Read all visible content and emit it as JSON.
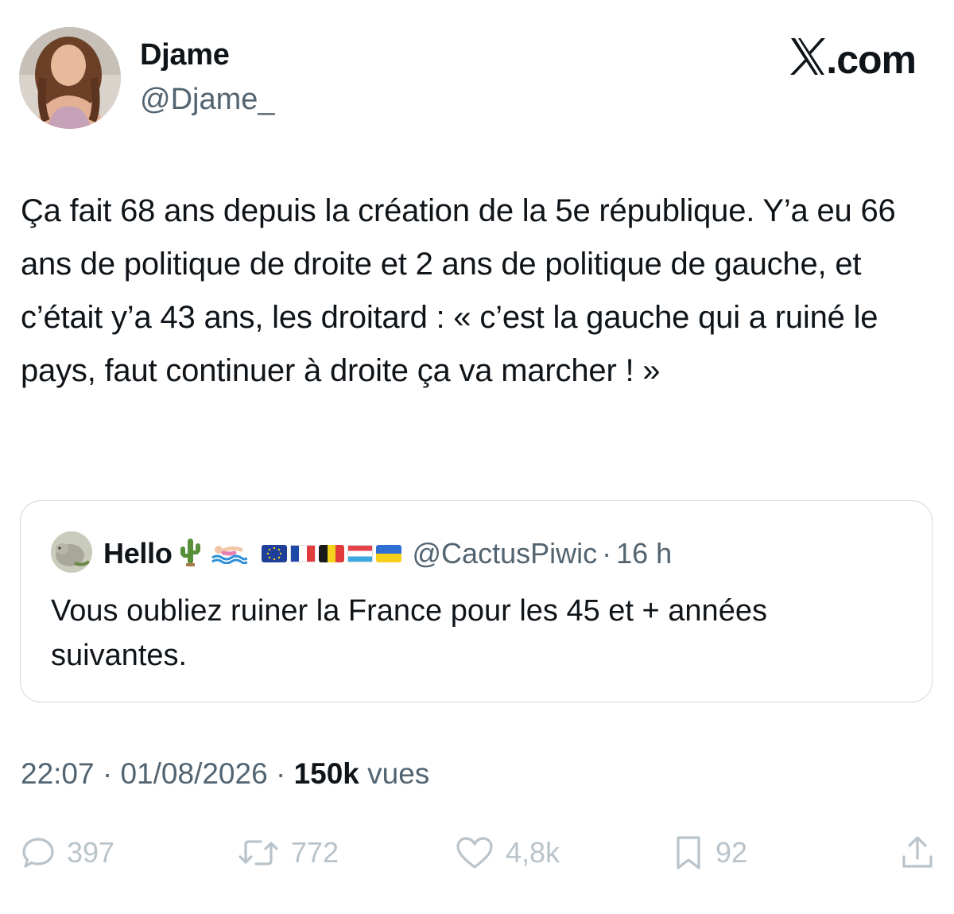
{
  "author": {
    "name": "Djame",
    "handle": "@Djame_"
  },
  "brand": {
    "label": ".com"
  },
  "tweet": {
    "text": "Ça fait 68 ans depuis la création de la 5e république. Y’a eu 66 ans de politique de droite et 2 ans de politique de gauche, et c’était y’a 43 ans, les droitard : « c’est la gauche qui a ruiné le pays, faut continuer à droite ça va marcher ! »"
  },
  "quote": {
    "name": "Hello",
    "emojis": [
      "cactus-icon",
      "swimmer-icon"
    ],
    "flags": [
      "eu-flag-icon",
      "france-flag-icon",
      "belgium-flag-icon",
      "luxembourg-flag-icon",
      "ukraine-flag-icon"
    ],
    "handle": "@CactusPiwic",
    "separator": "·",
    "time": "16 h",
    "text": "Vous oubliez ruiner la France pour les 45 et + années suivantes."
  },
  "meta": {
    "time": "22:07",
    "date": "01/08/2026",
    "separator": "·",
    "views_count": "150k",
    "views_label": "vues"
  },
  "actions": {
    "replies": "397",
    "retweets": "772",
    "likes": "4,8k",
    "bookmarks": "92"
  },
  "colors": {
    "text": "#0f1419",
    "secondary": "#536471",
    "action": "#b9c3ca",
    "border": "#cfd9de"
  }
}
